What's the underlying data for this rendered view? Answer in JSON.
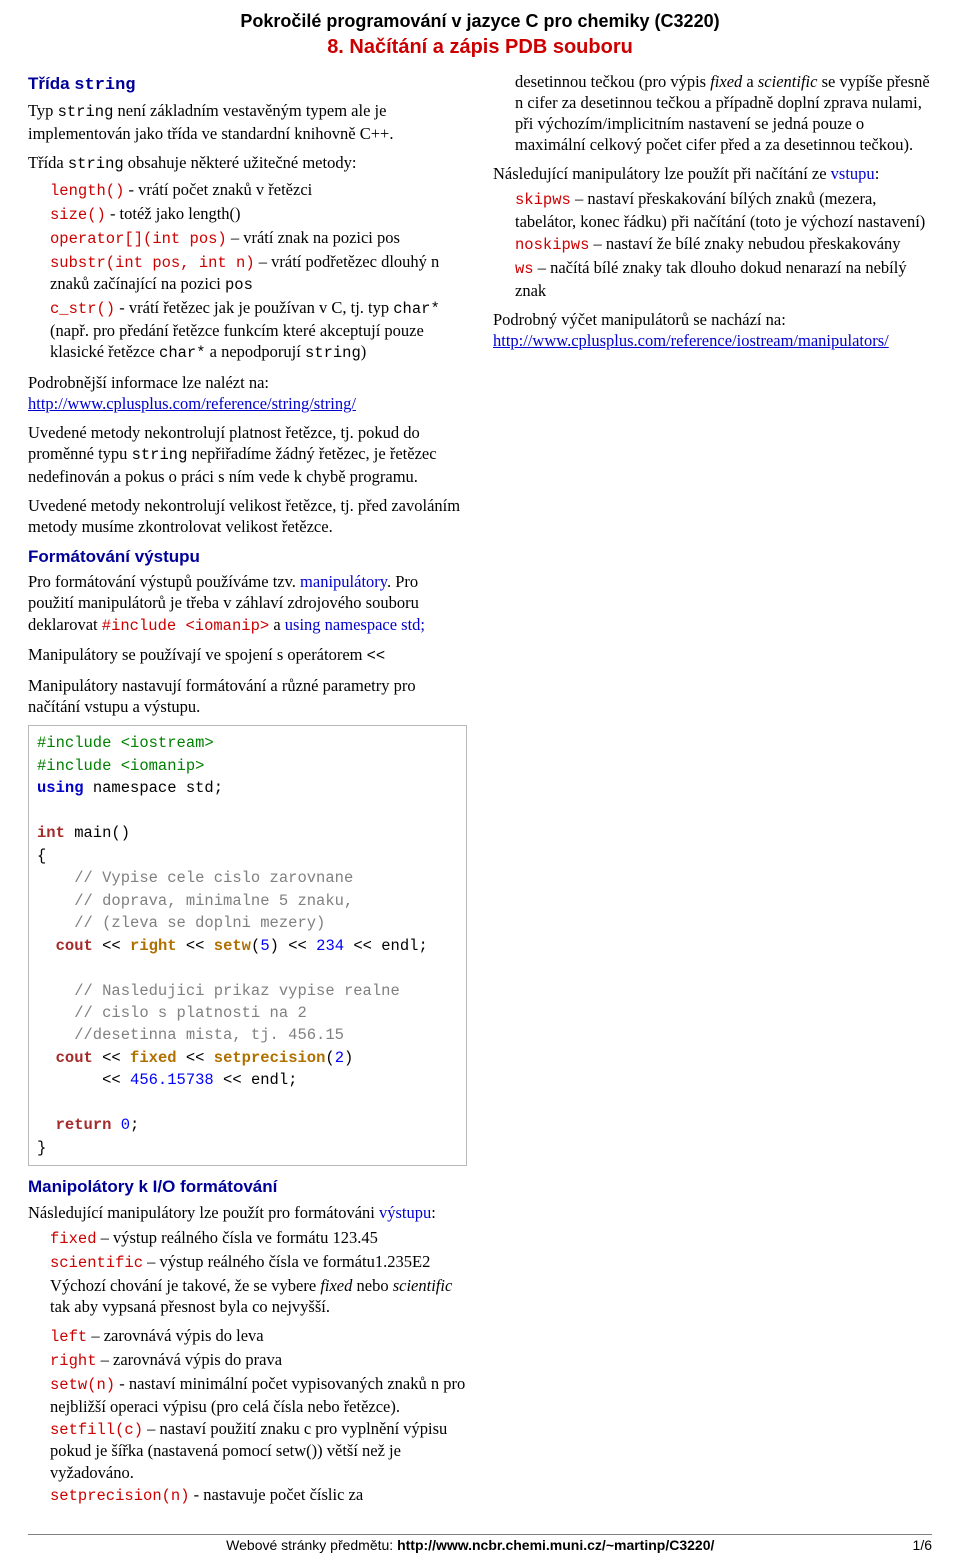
{
  "header": {
    "h1": "Pokročilé programování v jazyce C pro chemiky (C3220)",
    "h2": "8. Načítání a zápis PDB souboru"
  },
  "col1": {
    "s1_title_pre": "Třída ",
    "s1_title_code": "string",
    "p1_a": "Typ ",
    "p1_code1": "string",
    "p1_b": " není základním vestavěným typem ale je implementován jako třída ve standardní knihovně C++.",
    "p2_a": "Třída ",
    "p2_code1": "string",
    "p2_b": " obsahuje některé užitečné metody:",
    "m_length_code": "length()",
    "m_length_txt": " - vrátí počet znaků v řetězci",
    "m_size_code": "size()",
    "m_size_txt": " - totéž jako length()",
    "m_op_code": "operator[](int pos)",
    "m_op_txt": " – vrátí znak na pozici pos",
    "m_substr_code": "substr(int pos, int n)",
    "m_substr_txt_a": " – vrátí podřetězec dlouhý n znaků začínající na pozici ",
    "m_substr_txt_code": "pos",
    "m_cstr_code": "c_str()",
    "m_cstr_txt_a": " - vrátí řetězec jak je používan v C, tj. typ ",
    "m_cstr_txt_code1": "char*",
    "m_cstr_txt_b": " (např. pro předání řetězce funkcím které akceptují pouze klasické řetězce ",
    "m_cstr_txt_code2": "char*",
    "m_cstr_txt_c": " a nepodporují ",
    "m_cstr_txt_code3": "string",
    "m_cstr_txt_d": ")",
    "p3_a": "Podrobnější informace lze nalézt na: ",
    "p3_link": "http://www.cplusplus.com/reference/string/string/",
    "p4_a": "Uvedené metody nekontrolují platnost řetězce, tj. pokud do proměnné typu ",
    "p4_code": "string",
    "p4_b": " nepřiřadíme žádný řetězec, je řetězec nedefinován a pokus o práci s ním vede k chybě programu.",
    "p5": "Uvedené metody nekontrolují velikost řetězce, tj. před zavoláním metody musíme zkontrolovat velikost řetězce.",
    "s2_title": "Formátování výstupu",
    "p6_a": "Pro formátování výstupů používáme tzv. ",
    "p6_link": "manipulátory",
    "p6_b": ". Pro použití manipulátorů je třeba v záhlaví zdrojového souboru deklarovat ",
    "p6_code": "#include <iomanip>",
    "p6_c": " a ",
    "p6_link2": "using namespace std;",
    "p7_a": "Manipulátory se používají ve spojení s operátorem ",
    "p7_code": "<<",
    "p8": "Manipulátory nastavují formátování a různé parametry pro načítání vstupu a výstupu.",
    "s3_title": "Manipolátory k I/O formátování",
    "p9_a": "Následující manipulátory lze použít pro formátováni ",
    "p9_link": "výstupu",
    "p9_b": ":",
    "mf_fixed_code": "fixed",
    "mf_fixed_txt": " – výstup reálného čísla ve formátu 123.45",
    "mf_sci_code": "scientific",
    "mf_sci_txt": " – výstup reálného čísla ve formátu1.235E2",
    "mf_behav_a": "Výchozí chování je takové, že se vybere ",
    "mf_behav_i1": "fixed",
    "mf_behav_b": " nebo ",
    "mf_behav_i2": "scientific",
    "mf_behav_c": " tak aby vypsaná přesnost byla co nejvyšší.",
    "mf_left_code": "left",
    "mf_left_txt": " – zarovnává výpis do leva",
    "mf_right_code": "right",
    "mf_right_txt": " – zarovnává výpis do prava",
    "mf_setw_code": "setw(n)",
    "mf_setw_txt": " - nastaví minimální počet vypisovaných znaků n pro nejbližší operaci výpisu (pro celá čísla nebo řetězce).",
    "mf_setfill_code": "setfill(c)",
    "mf_setfill_txt": " – nastaví použití znaku c pro vyplnění výpisu pokud je šířka (nastavená pomocí setw()) větší než je vyžadováno.",
    "mf_setprec_code": "setprecision(n)",
    "mf_setprec_txt": " - nastavuje počet číslic za"
  },
  "col2": {
    "p1_a": "desetinnou tečkou (pro výpis ",
    "p1_i1": "fixed",
    "p1_b": " a ",
    "p1_i2": "scientific",
    "p1_c": " se vypíše přesně n cifer za desetinnou tečkou a případně doplní zprava nulami, při výchozím/implicitním nastavení se jedná pouze o maximální celkový počet cifer před a za desetinnou tečkou).",
    "p2_a": "Následující manipulátory lze použít při načítání ze ",
    "p2_link": "vstupu",
    "p2_b": ":",
    "m_skip_code": "skipws",
    "m_skip_txt": " – nastaví přeskakování bílých znaků (mezera, tabelátor, konec řádku) při načítání (toto je výchozí nastavení)",
    "m_noskip_code": "noskipws",
    "m_noskip_txt": " – nastaví že bílé znaky nebudou přeskakovány",
    "m_ws_code": "ws",
    "m_ws_txt": " – načítá bílé znaky tak dlouho dokud nenarazí na nebílý znak",
    "p3_a": "Podrobný výčet manipulátorů se nachází na: ",
    "p3_link": "http://www.cplusplus.com/reference/iostream/manipulators/"
  },
  "code": {
    "l1": "#include <iostream>",
    "l2": "#include <iomanip>",
    "l3a": "using",
    "l3b": " namespace std;",
    "l5a": "int",
    "l5b": " main()",
    "l6": "{",
    "l7": "    // Vypise cele cislo zarovnane",
    "l8": "    // doprava, minimalne 5 znaku,",
    "l9": "    // (zleva se doplni mezery)",
    "l10_a": "  ",
    "l10_cout": "cout",
    "l10_b": " << ",
    "l10_right": "right",
    "l10_c": " << ",
    "l10_setw": "setw",
    "l10_d": "(",
    "l10_n5": "5",
    "l10_e": ") << ",
    "l10_n234": "234",
    "l10_f": " << endl;",
    "l12": "    // Nasledujici prikaz vypise realne",
    "l13": "    // cislo s platnosti na 2",
    "l14": "    //desetinna mista, tj. 456.15",
    "l15_a": "  ",
    "l15_cout": "cout",
    "l15_b": " << ",
    "l15_fixed": "fixed",
    "l15_c": " << ",
    "l15_sp": "setprecision",
    "l15_d": "(",
    "l15_n2": "2",
    "l15_e": ")",
    "l16_a": "       << ",
    "l16_n": "456.15738",
    "l16_b": " << endl;",
    "l18_a": "  ",
    "l18_ret": "return",
    "l18_b": " ",
    "l18_n0": "0",
    "l18_c": ";",
    "l19": "}"
  },
  "footer": {
    "text_a": "Webové stránky předmětu: ",
    "text_b": "http://www.ncbr.chemi.muni.cz/~martinp/C3220/",
    "page": "1/6"
  }
}
